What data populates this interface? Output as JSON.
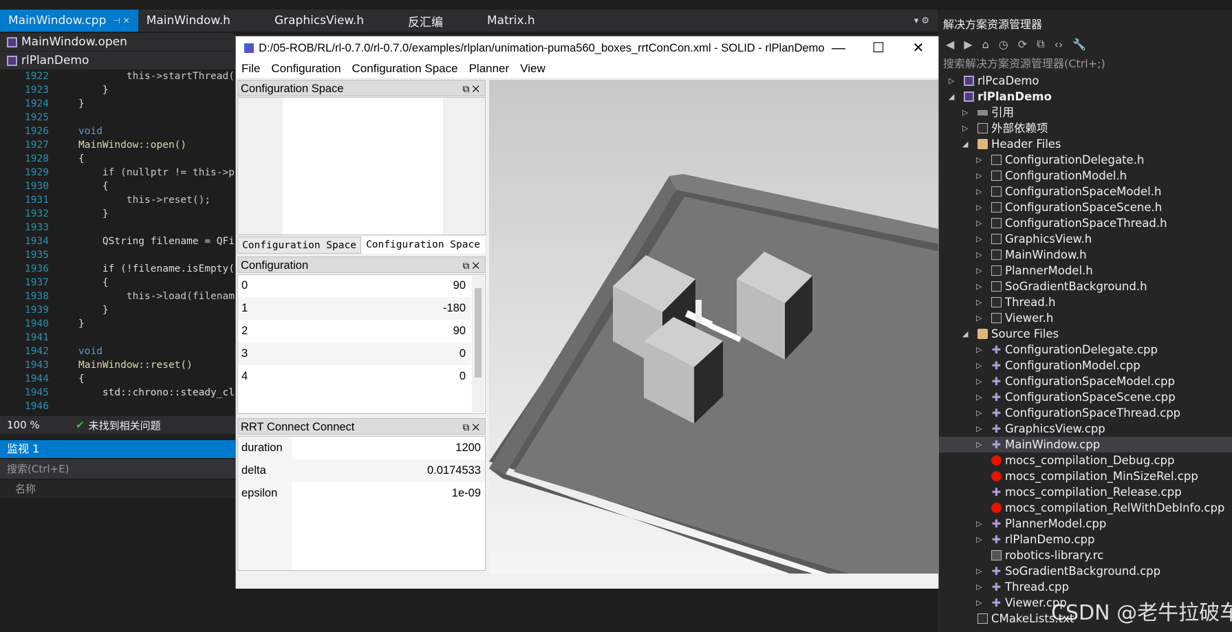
{
  "editor": {
    "tabs": [
      {
        "label": "MainWindow.cpp",
        "pin": "⊣ ✕"
      },
      {
        "label": "MainWindow.h"
      },
      {
        "label": "GraphicsView.h"
      },
      {
        "label": "反汇编"
      },
      {
        "label": "Matrix.h"
      }
    ],
    "nav_member": "MainWindow.open",
    "nav_project": "rlPlanDemo",
    "lines": [
      {
        "n": "1922",
        "t": "        this->startThread();"
      },
      {
        "n": "1923",
        "t": "    }"
      },
      {
        "n": "1924",
        "t": "}"
      },
      {
        "n": "1925",
        "t": ""
      },
      {
        "n": "1926",
        "t": "void"
      },
      {
        "n": "1927",
        "t": "MainWindow::open()"
      },
      {
        "n": "1928",
        "t": "{"
      },
      {
        "n": "1929",
        "t": "    if (nullptr != this->pla"
      },
      {
        "n": "1930",
        "t": "    {"
      },
      {
        "n": "1931",
        "t": "        this->reset();"
      },
      {
        "n": "1932",
        "t": "    }"
      },
      {
        "n": "1933",
        "t": ""
      },
      {
        "n": "1934",
        "t": "    QString filename = QFile"
      },
      {
        "n": "1935",
        "t": ""
      },
      {
        "n": "1936",
        "t": "    if (!filename.isEmpty())"
      },
      {
        "n": "1937",
        "t": "    {"
      },
      {
        "n": "1938",
        "t": "        this->load(filename)"
      },
      {
        "n": "1939",
        "t": "    }"
      },
      {
        "n": "1940",
        "t": "}"
      },
      {
        "n": "1941",
        "t": ""
      },
      {
        "n": "1942",
        "t": "void"
      },
      {
        "n": "1943",
        "t": "MainWindow::reset()"
      },
      {
        "n": "1944",
        "t": "{"
      },
      {
        "n": "1945",
        "t": "    std::chrono::steady_cloc"
      },
      {
        "n": "1946",
        "t": ""
      }
    ],
    "zoom": "100 %",
    "issues": "未找到相关问题"
  },
  "watch": {
    "title": "监视 1",
    "search_placeholder": "搜索(Ctrl+E)",
    "col_name": "名称"
  },
  "solution_explorer": {
    "title": "解决方案资源管理器",
    "search_placeholder": "搜索解决方案资源管理器(Ctrl+;)",
    "items": [
      {
        "label": "rlPcaDemo",
        "kind": "proj",
        "level": 0,
        "arrow": "▷"
      },
      {
        "label": "rlPlanDemo",
        "kind": "proj",
        "level": 0,
        "arrow": "◢",
        "bold": true
      },
      {
        "label": "引用",
        "kind": "ref",
        "level": 1,
        "arrow": "▷"
      },
      {
        "label": "外部依赖项",
        "kind": "dep",
        "level": 1,
        "arrow": "▷"
      },
      {
        "label": "Header Files",
        "kind": "folder",
        "level": 1,
        "arrow": "◢"
      },
      {
        "label": "ConfigurationDelegate.h",
        "kind": "file",
        "level": 2,
        "arrow": "▷"
      },
      {
        "label": "ConfigurationModel.h",
        "kind": "file",
        "level": 2,
        "arrow": "▷"
      },
      {
        "label": "ConfigurationSpaceModel.h",
        "kind": "file",
        "level": 2,
        "arrow": "▷"
      },
      {
        "label": "ConfigurationSpaceScene.h",
        "kind": "file",
        "level": 2,
        "arrow": "▷"
      },
      {
        "label": "ConfigurationSpaceThread.h",
        "kind": "file",
        "level": 2,
        "arrow": "▷"
      },
      {
        "label": "GraphicsView.h",
        "kind": "file",
        "level": 2,
        "arrow": "▷"
      },
      {
        "label": "MainWindow.h",
        "kind": "file",
        "level": 2,
        "arrow": "▷"
      },
      {
        "label": "PlannerModel.h",
        "kind": "file",
        "level": 2,
        "arrow": "▷"
      },
      {
        "label": "SoGradientBackground.h",
        "kind": "file",
        "level": 2,
        "arrow": "▷"
      },
      {
        "label": "Thread.h",
        "kind": "file",
        "level": 2,
        "arrow": "▷"
      },
      {
        "label": "Viewer.h",
        "kind": "file",
        "level": 2,
        "arrow": "▷"
      },
      {
        "label": "Source Files",
        "kind": "folder",
        "level": 1,
        "arrow": "◢"
      },
      {
        "label": "ConfigurationDelegate.cpp",
        "kind": "cpp",
        "level": 2,
        "arrow": "▷"
      },
      {
        "label": "ConfigurationModel.cpp",
        "kind": "cpp",
        "level": 2,
        "arrow": "▷"
      },
      {
        "label": "ConfigurationSpaceModel.cpp",
        "kind": "cpp",
        "level": 2,
        "arrow": "▷"
      },
      {
        "label": "ConfigurationSpaceScene.cpp",
        "kind": "cpp",
        "level": 2,
        "arrow": "▷"
      },
      {
        "label": "ConfigurationSpaceThread.cpp",
        "kind": "cpp",
        "level": 2,
        "arrow": "▷"
      },
      {
        "label": "GraphicsView.cpp",
        "kind": "cpp",
        "level": 2,
        "arrow": "▷"
      },
      {
        "label": "MainWindow.cpp",
        "kind": "cpp",
        "level": 2,
        "arrow": "▷",
        "selected": true
      },
      {
        "label": "mocs_compilation_Debug.cpp",
        "kind": "err",
        "level": 2,
        "arrow": ""
      },
      {
        "label": "mocs_compilation_MinSizeRel.cpp",
        "kind": "err",
        "level": 2,
        "arrow": ""
      },
      {
        "label": "mocs_compilation_Release.cpp",
        "kind": "cpp",
        "level": 2,
        "arrow": ""
      },
      {
        "label": "mocs_compilation_RelWithDebInfo.cpp",
        "kind": "err",
        "level": 2,
        "arrow": ""
      },
      {
        "label": "PlannerModel.cpp",
        "kind": "cpp",
        "level": 2,
        "arrow": "▷"
      },
      {
        "label": "rlPlanDemo.cpp",
        "kind": "cpp",
        "level": 2,
        "arrow": "▷"
      },
      {
        "label": "robotics-library.rc",
        "kind": "rc",
        "level": 2,
        "arrow": ""
      },
      {
        "label": "SoGradientBackground.cpp",
        "kind": "cpp",
        "level": 2,
        "arrow": "▷"
      },
      {
        "label": "Thread.cpp",
        "kind": "cpp",
        "level": 2,
        "arrow": "▷"
      },
      {
        "label": "Viewer.cpp",
        "kind": "cpp",
        "level": 2,
        "arrow": "▷"
      },
      {
        "label": "CMakeLists.txt",
        "kind": "file",
        "level": 1,
        "arrow": ""
      }
    ]
  },
  "app": {
    "title": "D:/05-ROB/RL/rl-0.7.0/rl-0.7.0/examples/rlplan/unimation-puma560_boxes_rrtConCon.xml - SOLID - rlPlanDemo",
    "window_buttons": {
      "minimize": "—",
      "maximize": "☐",
      "close": "✕"
    },
    "menu": [
      "File",
      "Configuration",
      "Configuration Space",
      "Planner",
      "View"
    ],
    "cspace_dock": {
      "title": "Configuration Space",
      "tabs": [
        "Configuration Space",
        "Configuration Space"
      ]
    },
    "config_dock": {
      "title": "Configuration",
      "rows": [
        {
          "k": "0",
          "v": "90"
        },
        {
          "k": "1",
          "v": "-180"
        },
        {
          "k": "2",
          "v": "90"
        },
        {
          "k": "3",
          "v": "0"
        },
        {
          "k": "4",
          "v": "0"
        }
      ]
    },
    "planner_dock": {
      "title": "RRT Connect Connect",
      "rows": [
        {
          "k": "duration",
          "v": "1200"
        },
        {
          "k": "delta",
          "v": "0.0174533"
        },
        {
          "k": "epsilon",
          "v": "1e-09"
        }
      ]
    },
    "dock_buttons": "⧉  ✕"
  },
  "watermark": "CSDN @老牛拉破车"
}
